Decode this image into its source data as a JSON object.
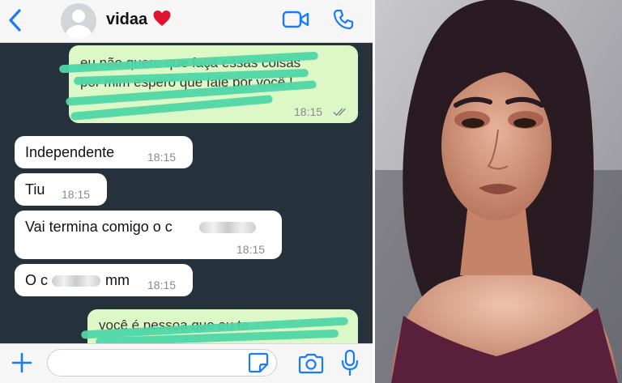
{
  "chat": {
    "contact_name": "vidaa",
    "contact_emoji": "heart-emoji",
    "messages": [
      {
        "direction": "outgoing",
        "text": "eu não quero que faça essas coisas por mim espero que fale por você !",
        "time": "18:15",
        "status": "read-checks-icon",
        "obscured": true
      },
      {
        "direction": "incoming",
        "text": "Independente",
        "time": "18:15"
      },
      {
        "direction": "incoming",
        "text": "Tiu",
        "time": "18:15"
      },
      {
        "direction": "incoming",
        "text": "Vai termina comigo o c",
        "time": "18:15",
        "blurred_tail": true
      },
      {
        "direction": "incoming",
        "text_before": "O c",
        "text_after": "mm",
        "time": "18:15",
        "blurred_middle": true
      },
      {
        "direction": "outgoing",
        "text": "você é pessoa que eu te",
        "obscured": true
      }
    ]
  },
  "composer": {
    "placeholder": ""
  },
  "colors": {
    "chat_background": "#25313b",
    "incoming_bubble": "#ffffff",
    "outgoing_bubble": "#dcf8c6",
    "ios_blue": "#1a7cf5",
    "scribble": "#4fd6a6"
  },
  "icons": [
    "back-chevron-icon",
    "contact-avatar",
    "heart-emoji",
    "video-call-icon",
    "phone-call-icon",
    "plus-icon",
    "sticker-icon",
    "camera-icon",
    "microphone-icon"
  ]
}
